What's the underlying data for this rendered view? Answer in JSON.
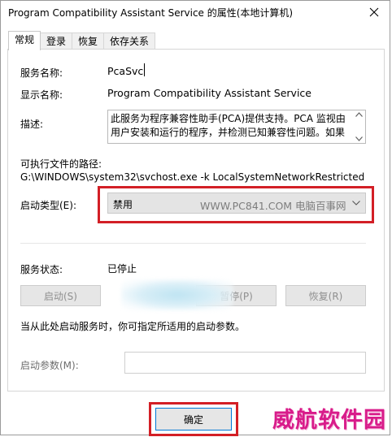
{
  "window": {
    "title": "Program Compatibility Assistant Service 的属性(本地计算机)"
  },
  "tabs": [
    {
      "label": "常规",
      "active": true
    },
    {
      "label": "登录",
      "active": false
    },
    {
      "label": "恢复",
      "active": false
    },
    {
      "label": "依存关系",
      "active": false
    }
  ],
  "general": {
    "service_name_label": "服务名称:",
    "service_name_value": "PcaSvc",
    "display_name_label": "显示名称:",
    "display_name_value": "Program Compatibility Assistant Service",
    "description_label": "描述:",
    "description_value": "此服务为程序兼容性助手(PCA)提供支持。PCA 监视由用户安装和运行的程序，并检测已知兼容性问题。如果",
    "exe_path_label": "可执行文件的路径:",
    "exe_path_value": "G:\\WINDOWS\\system32\\svchost.exe -k LocalSystemNetworkRestricted",
    "startup_type_label": "启动类型(E):",
    "startup_type_value": "禁用",
    "watermark": "WWW.PC841.COM 电脑百事网",
    "service_status_label": "服务状态:",
    "service_status_value": "已停止",
    "buttons": {
      "start": "启动(S)",
      "pause": "暂停(P)",
      "resume": "恢复(R)"
    },
    "hint_text": "当从此处启动服务时，你可指定所适用的启动参数。",
    "start_params_label": "启动参数(M):",
    "start_params_value": ""
  },
  "footer": {
    "ok_label": "确定"
  },
  "overlay": {
    "site_logo": "威航软件园"
  },
  "colors": {
    "highlight_frame": "#d31f26",
    "logo": "#d81b8a",
    "focus_border": "#0078d7"
  }
}
